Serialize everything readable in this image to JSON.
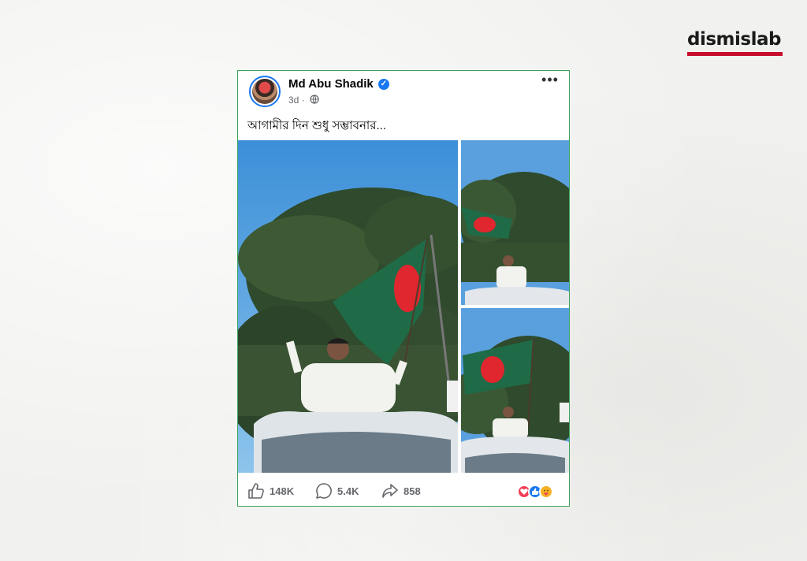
{
  "brand": {
    "name": "dismislab",
    "accent_color": "#c8102e"
  },
  "post": {
    "author": "Md Abu Shadik",
    "verified": true,
    "time": "3d",
    "audience_icon": "globe-icon",
    "caption": "আগামীর দিন শুধু সম্ভাবনার...",
    "photos": [
      {
        "name": "main-photo",
        "alt": "Man waving a Bangladesh flag from a car sunroof"
      },
      {
        "name": "top-right-photo",
        "alt": "Man with flag on car roof"
      },
      {
        "name": "bottom-right-photo",
        "alt": "Man holding flag above car"
      }
    ],
    "stats": {
      "likes": "148K",
      "comments": "5.4K",
      "shares": "858"
    },
    "reactions": [
      "love",
      "like",
      "care"
    ]
  },
  "colors": {
    "facebook_blue": "#1877f2",
    "flag_green": "#006a4e",
    "flag_red": "#f42a41",
    "post_border": "#3aa35c"
  }
}
